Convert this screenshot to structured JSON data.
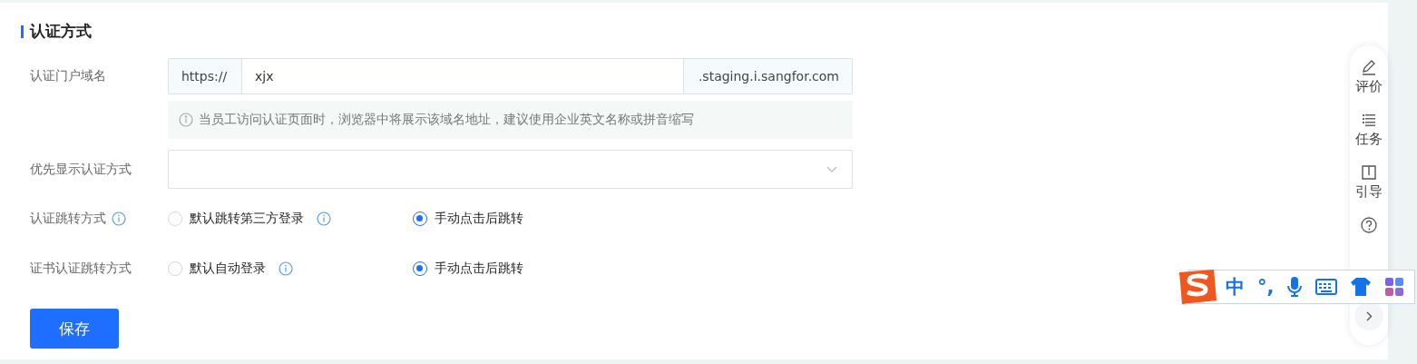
{
  "section": {
    "title": "认证方式"
  },
  "domain": {
    "label": "认证门户域名",
    "prefix": "https://",
    "value": "xjx",
    "suffix": ".staging.i.sangfor.com",
    "hint": "当员工访问认证页面时，浏览器中将展示该域名地址，建议使用企业英文名称或拼音缩写"
  },
  "priority": {
    "label": "优先显示认证方式"
  },
  "radio_groups": [
    {
      "label": "认证跳转方式",
      "info": true,
      "options": [
        {
          "label": "默认跳转第三方登录",
          "info": true,
          "selected": false
        },
        {
          "label": "手动点击后跳转",
          "info": false,
          "selected": true
        }
      ]
    },
    {
      "label": "证书认证跳转方式",
      "info": false,
      "options": [
        {
          "label": "默认自动登录",
          "info": true,
          "selected": false
        },
        {
          "label": "手动点击后跳转",
          "info": false,
          "selected": true
        }
      ]
    }
  ],
  "save_button": "保存",
  "side_toolbar": {
    "items": [
      {
        "kind": "rate",
        "label": "评价"
      },
      {
        "kind": "tasks",
        "label": "任务"
      },
      {
        "kind": "guide",
        "label": "引导"
      },
      {
        "kind": "help"
      }
    ]
  },
  "ime_bar": {
    "items": [
      {
        "kind": "logo"
      },
      {
        "kind": "text",
        "label": "中"
      },
      {
        "kind": "text",
        "label": "°,"
      },
      {
        "kind": "mic"
      },
      {
        "kind": "keyboard"
      },
      {
        "kind": "skin"
      },
      {
        "kind": "apps"
      }
    ]
  }
}
